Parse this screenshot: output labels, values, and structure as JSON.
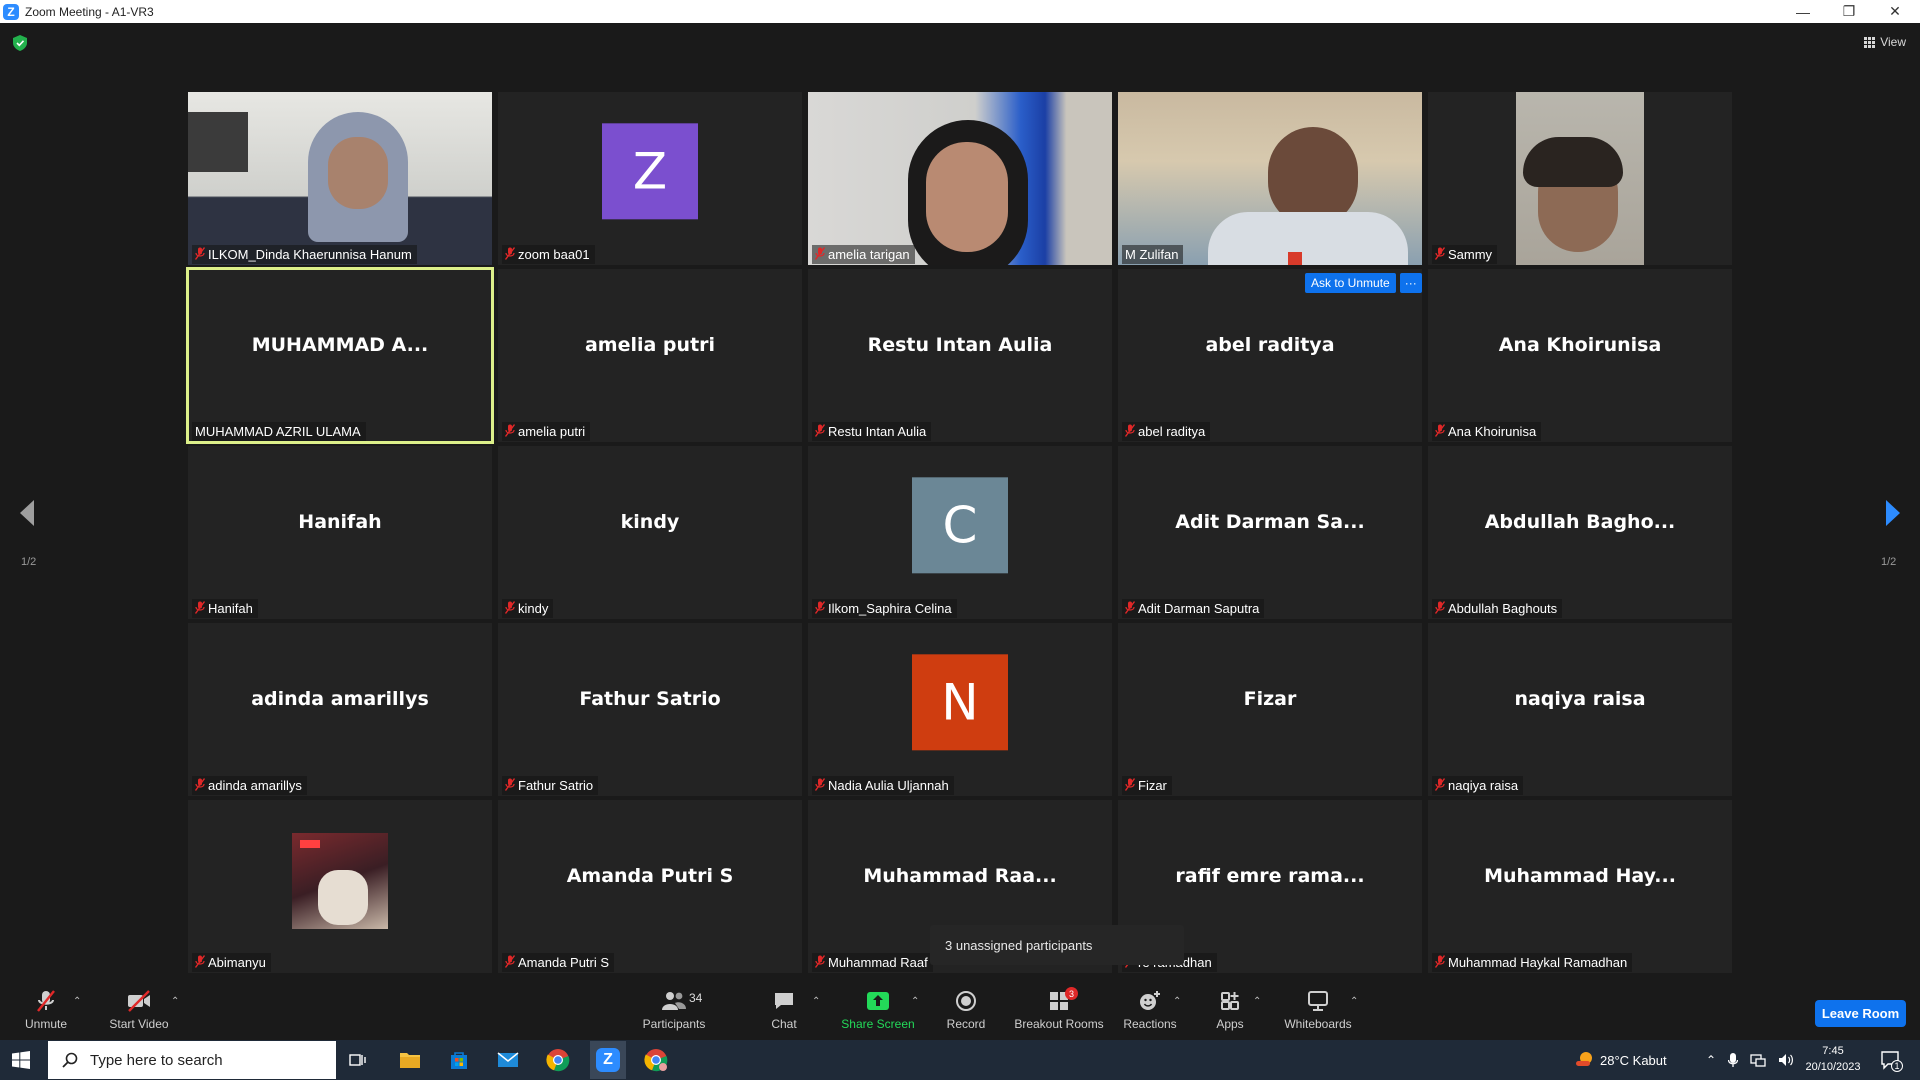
{
  "window": {
    "title": "Zoom Meeting - A1-VR3",
    "controls": [
      "minimize",
      "restore",
      "close"
    ]
  },
  "top": {
    "view_label": "View"
  },
  "nav": {
    "page_indicator": "1/2"
  },
  "tiles": [
    {
      "name": "ILKOM_Dinda Khaerunnisa Hanum",
      "video": true,
      "muted": true
    },
    {
      "name": "zoom baa01",
      "avatar_letter": "Z",
      "avatar_color": "#7b4fcf",
      "muted": true
    },
    {
      "name": "amelia tarigan",
      "video": true,
      "muted": true
    },
    {
      "name": "M Zulifan",
      "video": true,
      "muted": false
    },
    {
      "name": "Sammy",
      "video": true,
      "muted": true
    },
    {
      "name": "MUHAMMAD AZRIL ULAMA",
      "display": "MUHAMMAD  A...",
      "muted": false,
      "active": true
    },
    {
      "name": "amelia putri",
      "display": "amelia putri",
      "muted": true
    },
    {
      "name": "Restu Intan Aulia",
      "display": "Restu Intan Aulia",
      "muted": true
    },
    {
      "name": "abel raditya",
      "display": "abel raditya",
      "muted": true
    },
    {
      "name": "Ana Khoirunisa",
      "display": "Ana Khoirunisa",
      "muted": true
    },
    {
      "name": "Hanifah",
      "display": "Hanifah",
      "muted": true
    },
    {
      "name": "kindy",
      "display": "kindy",
      "muted": true
    },
    {
      "name": "Ilkom_Saphira Celina",
      "avatar_letter": "C",
      "avatar_color": "#6b8796",
      "muted": true
    },
    {
      "name": "Adit Darman Saputra",
      "display": "Adit Darman Sa...",
      "muted": true
    },
    {
      "name": "Abdullah Baghouts",
      "display": "Abdullah  Bagho...",
      "muted": true
    },
    {
      "name": "adinda amarillys",
      "display": "adinda amarillys",
      "muted": true
    },
    {
      "name": "Fathur Satrio",
      "display": "Fathur Satrio",
      "muted": true
    },
    {
      "name": "Nadia Aulia Uljannah",
      "avatar_letter": "N",
      "avatar_color": "#cf3d10",
      "muted": true
    },
    {
      "name": "Fizar",
      "display": "Fizar",
      "muted": true
    },
    {
      "name": "naqiya raisa",
      "display": "naqiya raisa",
      "muted": true
    },
    {
      "name": "Abimanyu",
      "photo": true,
      "muted": true
    },
    {
      "name": "Amanda Putri S",
      "display": "Amanda Putri S",
      "muted": true
    },
    {
      "name": "Muhammad Raaf",
      "display": "Muhammad  Raa...",
      "muted": true
    },
    {
      "name": "re ramadhan",
      "display": "rafif emre rama...",
      "muted": true
    },
    {
      "name": "Muhammad Haykal Ramadhan",
      "display": "Muhammad  Hay...",
      "muted": true
    }
  ],
  "hover": {
    "ask_to_unmute": "Ask to Unmute",
    "more": "···"
  },
  "tooltip": "3 unassigned participants",
  "toolbar": {
    "unmute": "Unmute",
    "start_video": "Start Video",
    "participants": "Participants",
    "participants_count": "34",
    "chat": "Chat",
    "share_screen": "Share Screen",
    "record": "Record",
    "breakout_rooms": "Breakout Rooms",
    "breakout_badge": "3",
    "reactions": "Reactions",
    "apps": "Apps",
    "whiteboards": "Whiteboards",
    "leave": "Leave Room",
    "share_color": "#23d959",
    "leave_color": "#0e72ed"
  },
  "taskbar": {
    "search_placeholder": "Type here to search",
    "weather": "28°C  Kabut",
    "time": "7:45",
    "date": "20/10/2023",
    "notifications": "1"
  }
}
